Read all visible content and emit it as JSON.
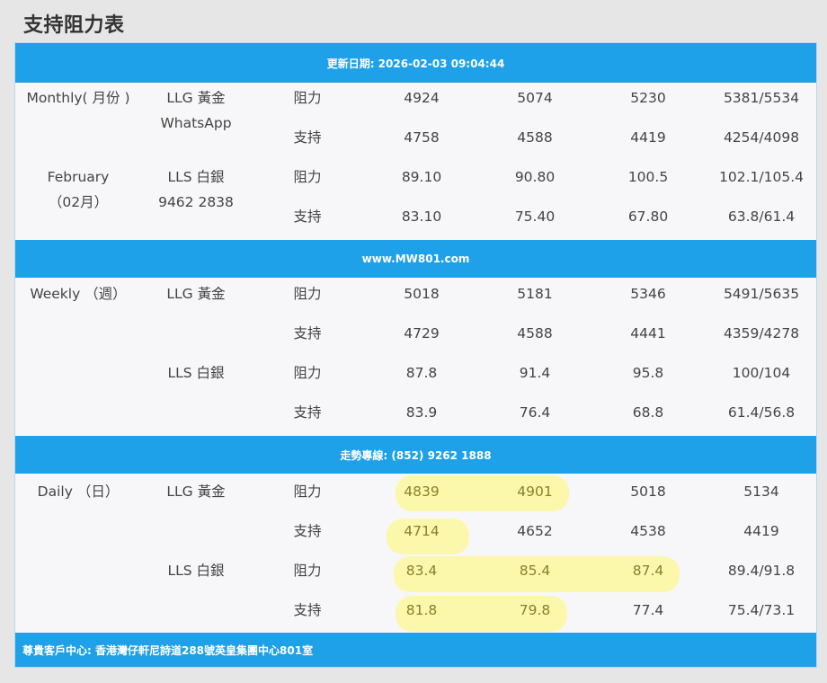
{
  "page_title": "支持阻力表",
  "bars": {
    "updated": "更新日期: 2026-02-03 09:04:44",
    "website": "www.MW801.com",
    "hotline": "走勢專線: (852) 9262 1888",
    "address": "尊貴客戶中心: 香港灣仔軒尼詩道288號英皇集團中心801室"
  },
  "monthly": {
    "period_line1": "Monthly( 月份 )",
    "period_line2": "February",
    "period_line3": "（02月）",
    "llg_label": "LLG 黃金",
    "contact_line1": "WhatsApp",
    "lls_label": "LLS 白銀",
    "contact_line2": "9462 2838",
    "rows": [
      {
        "type": "阻力",
        "v1": "4924",
        "v2": "5074",
        "v3": "5230",
        "v4": "5381/5534"
      },
      {
        "type": "支持",
        "v1": "4758",
        "v2": "4588",
        "v3": "4419",
        "v4": "4254/4098"
      },
      {
        "type": "阻力",
        "v1": "89.10",
        "v2": "90.80",
        "v3": "100.5",
        "v4": "102.1/105.4"
      },
      {
        "type": "支持",
        "v1": "83.10",
        "v2": "75.40",
        "v3": "67.80",
        "v4": "63.8/61.4"
      }
    ]
  },
  "weekly": {
    "period_line1": "Weekly （週）",
    "llg_label": "LLG 黃金",
    "lls_label": "LLS 白銀",
    "rows": [
      {
        "type": "阻力",
        "v1": "5018",
        "v2": "5181",
        "v3": "5346",
        "v4": "5491/5635"
      },
      {
        "type": "支持",
        "v1": "4729",
        "v2": "4588",
        "v3": "4441",
        "v4": "4359/4278"
      },
      {
        "type": "阻力",
        "v1": "87.8",
        "v2": "91.4",
        "v3": "95.8",
        "v4": "100/104"
      },
      {
        "type": "支持",
        "v1": "83.9",
        "v2": "76.4",
        "v3": "68.8",
        "v4": "61.4/56.8"
      }
    ]
  },
  "daily": {
    "period_line1": "Daily （日）",
    "llg_label": "LLG 黃金",
    "lls_label": "LLS 白銀",
    "rows": [
      {
        "type": "阻力",
        "v1": "4839",
        "v2": "4901",
        "v3": "5018",
        "v4": "5134"
      },
      {
        "type": "支持",
        "v1": "4714",
        "v2": "4652",
        "v3": "4538",
        "v4": "4419"
      },
      {
        "type": "阻力",
        "v1": "83.4",
        "v2": "85.4",
        "v3": "87.4",
        "v4": "89.4/91.8"
      },
      {
        "type": "支持",
        "v1": "81.8",
        "v2": "79.8",
        "v3": "77.4",
        "v4": "75.4/73.1"
      }
    ]
  },
  "colors": {
    "header_bar": "#1ea1e8",
    "highlight": "#fffa6e"
  }
}
